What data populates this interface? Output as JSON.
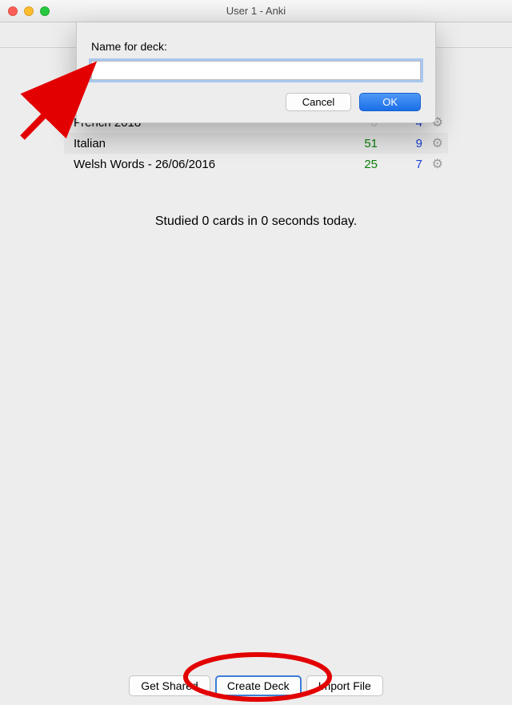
{
  "window": {
    "title": "User 1 - Anki"
  },
  "dialog": {
    "label": "Name for deck:",
    "input_value": "",
    "cancel_label": "Cancel",
    "ok_label": "OK"
  },
  "decks": [
    {
      "name": "French 2018",
      "due": "0",
      "due_zero": true,
      "new": "4"
    },
    {
      "name": "Italian",
      "due": "51",
      "due_zero": false,
      "new": "9"
    },
    {
      "name": "Welsh Words - 26/06/2016",
      "due": "25",
      "due_zero": false,
      "new": "7"
    }
  ],
  "studied_text": "Studied 0 cards in 0 seconds today.",
  "bottom": {
    "get_shared": "Get Shared",
    "create_deck": "Create Deck",
    "import_file": "Import File"
  },
  "colors": {
    "annotation": "#e30000"
  }
}
